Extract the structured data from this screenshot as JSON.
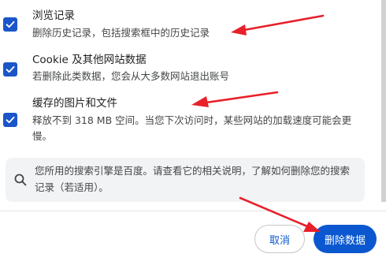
{
  "options": [
    {
      "title": "浏览记录",
      "description": "删除历史记录，包括搜索框中的历史记录",
      "checked": true
    },
    {
      "title": "Cookie 及其他网站数据",
      "description": "若删除此类数据，您会从大多数网站退出账号",
      "checked": true
    },
    {
      "title": "缓存的图片和文件",
      "description": "释放不到 318 MB 空间。当您下次访问时，某些网站的加载速度可能会更慢。",
      "checked": true
    }
  ],
  "info": {
    "icon": "search-icon",
    "text": "您所用的搜索引擎是百度。请查看它的相关说明，了解如何删除您的搜索记录（若适用）。"
  },
  "buttons": {
    "cancel_label": "取消",
    "delete_label": "删除数据"
  },
  "colors": {
    "accent": "#0b57d0",
    "checkbox": "#1a56c9",
    "annotation_arrow": "#e8202a"
  }
}
